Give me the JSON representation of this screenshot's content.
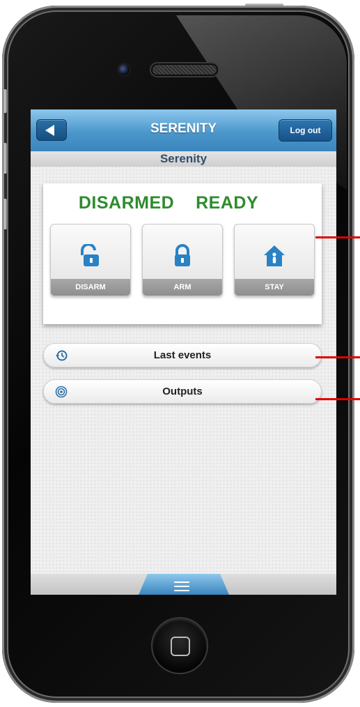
{
  "app": {
    "nav_title": "SERENITY",
    "logout_label": "Log out",
    "subheader_title": "Serenity",
    "back_icon": "back-arrow-icon"
  },
  "status": {
    "text": "DISARMED  READY",
    "color": "#2e8b2e"
  },
  "modes": [
    {
      "label": "DISARM",
      "icon": "unlocked-padlock-icon"
    },
    {
      "label": "ARM",
      "icon": "locked-padlock-icon"
    },
    {
      "label": "STAY",
      "icon": "house-person-icon"
    }
  ],
  "menu": [
    {
      "label": "Last events",
      "icon": "history-clock-icon"
    },
    {
      "label": "Outputs",
      "icon": "outputs-signal-icon"
    }
  ],
  "bottom": {
    "icon": "hamburger-menu-icon"
  },
  "colors": {
    "accent_blue": "#3a86bd",
    "annotation_red": "#e10000"
  }
}
